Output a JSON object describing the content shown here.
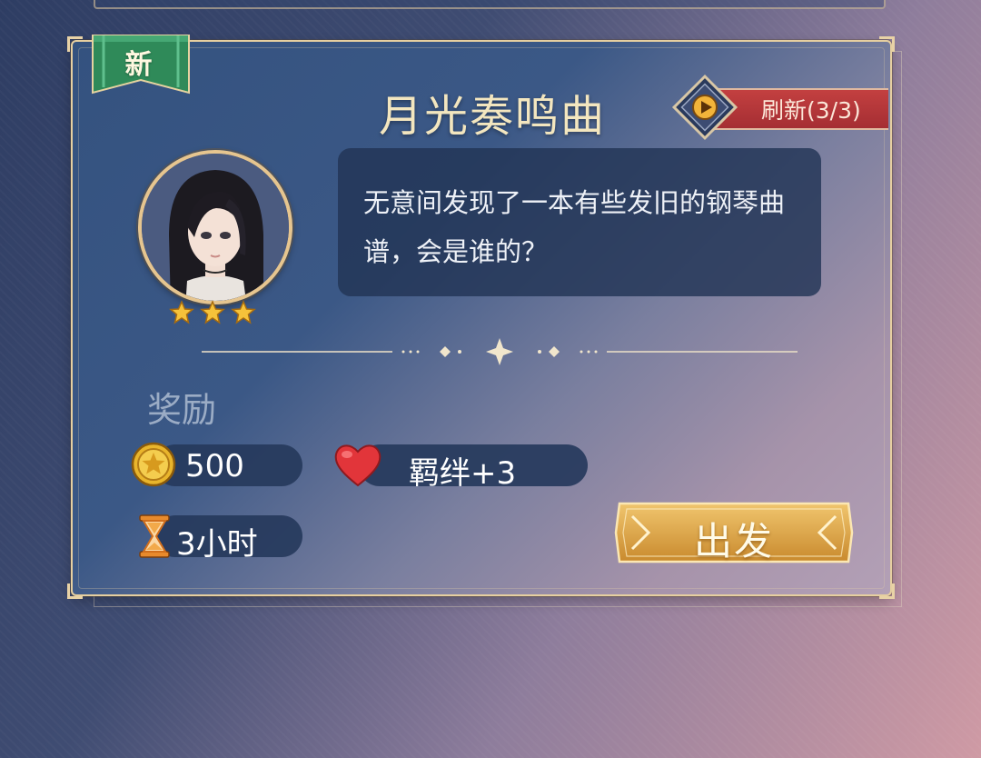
{
  "quest": {
    "badge": "新",
    "title": "月光奏鸣曲",
    "refresh_label": "刷新(3/3)",
    "description": "无意间发现了一本有些发旧的钢琴曲谱，会是谁的？",
    "rarity_stars": 3,
    "reward_label": "奖励",
    "rewards": {
      "coins": "500",
      "bond": "羁绊+3"
    },
    "duration": "3小时",
    "go_label": "出发"
  },
  "icons": [
    "new-ribbon",
    "play-icon",
    "character-portrait",
    "star-icon",
    "coin-icon",
    "heart-icon",
    "hourglass-icon"
  ],
  "colors": {
    "accent_gold": "#e6cfa0",
    "ribbon_green": "#2e8a5a",
    "refresh_red": "#b0363a",
    "button_gold": "#d9a44a",
    "heart_red": "#e23a3a"
  }
}
